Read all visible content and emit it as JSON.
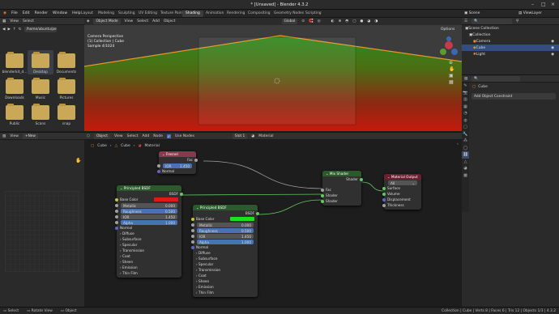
{
  "window": {
    "title": "* [Unsaved] - Blender 4.3.2"
  },
  "menu": [
    "File",
    "Edit",
    "Render",
    "Window",
    "Help"
  ],
  "workspaces": [
    "Layout",
    "Modeling",
    "Sculpting",
    "UV Editing",
    "Texture Paint",
    "Shading",
    "Animation",
    "Rendering",
    "Compositing",
    "Geometry Nodes",
    "Scripting"
  ],
  "active_workspace": "Shading",
  "scene": {
    "name": "Scene",
    "view_layer": "ViewLayer"
  },
  "filebrowser": {
    "view": "View",
    "select": "Select",
    "path": "/home/ubuntu/pete/",
    "items": [
      "blenderkit_d...",
      "Desktop",
      "Documents",
      "Downloads",
      "Music",
      "Pictures",
      "Public",
      "Scans",
      "snap"
    ]
  },
  "viewport": {
    "mode": "Object Mode",
    "view": "View",
    "select": "Select",
    "add": "Add",
    "object": "Object",
    "orientation": "Global",
    "options": "Options",
    "info_line1": "Camera Perspective",
    "info_line2": "(1) Collection | Cube",
    "info_line3": "Sample 4/1024"
  },
  "outliner": {
    "items": [
      {
        "label": "Scene Collection",
        "selected": false
      },
      {
        "label": "Collection",
        "selected": false
      },
      {
        "label": "Camera",
        "selected": false
      },
      {
        "label": "Cube",
        "selected": true
      },
      {
        "label": "Light",
        "selected": false
      }
    ]
  },
  "properties": {
    "object_name": "Cube",
    "add_constraint": "Add Object Constraint"
  },
  "image_editor": {
    "view": "View",
    "new": "New"
  },
  "node_editor": {
    "object": "Object",
    "view": "View",
    "select": "Select",
    "add": "Add",
    "node": "Node",
    "use_nodes": "Use Nodes",
    "slot": "Slot 1",
    "material_label": "Material",
    "breadcrumb": [
      "Cube",
      "Cube",
      "Material"
    ]
  },
  "nodes": {
    "fresnel": {
      "title": "Fresnel",
      "fac": "Fac",
      "ior_label": "IOR",
      "ior_value": "1.450",
      "normal": "Normal"
    },
    "bsdf1": {
      "title": "Principled BSDF",
      "out": "BSDF",
      "base_color": "Base Color",
      "metallic": "Metallic",
      "metallic_v": "0.000",
      "roughness": "Roughness",
      "roughness_v": "0.500",
      "ior": "IOR",
      "ior_v": "1.450",
      "alpha": "Alpha",
      "alpha_v": "1.000",
      "normal": "Normal",
      "panels": [
        "Diffuse",
        "Subsurface",
        "Specular",
        "Transmission",
        "Coat",
        "Sheen",
        "Emission",
        "Thin Film"
      ]
    },
    "bsdf2": {
      "title": "Principled BSDF",
      "out": "BSDF",
      "base_color": "Base Color",
      "metallic": "Metallic",
      "metallic_v": "0.000",
      "roughness": "Roughness",
      "roughness_v": "0.500",
      "ior": "IOR",
      "ior_v": "1.450",
      "alpha": "Alpha",
      "alpha_v": "1.000",
      "normal": "Normal",
      "panels": [
        "Diffuse",
        "Subsurface",
        "Specular",
        "Transmission",
        "Coat",
        "Sheen",
        "Emission",
        "Thin Film"
      ]
    },
    "mix": {
      "title": "Mix Shader",
      "out": "Shader",
      "fac": "Fac",
      "s1": "Shader",
      "s2": "Shader"
    },
    "output": {
      "title": "Material Output",
      "target": "All",
      "surface": "Surface",
      "volume": "Volume",
      "displacement": "Displacement",
      "thickness": "Thickness"
    }
  },
  "colors": {
    "bsdf1_base": "#e01818",
    "bsdf2_base": "#1ee01e",
    "accent": "#4772b3"
  },
  "status": {
    "left1": "Select",
    "left2": "Rotate View",
    "left3": "Object",
    "right": "Collection | Cube | Verts 8 | Faces 6 | Tris 12 | Objects 1/3 | 4.3.2"
  }
}
